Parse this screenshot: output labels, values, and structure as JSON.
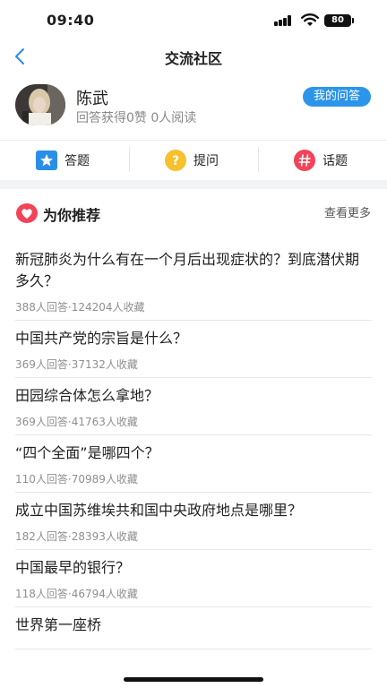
{
  "status": {
    "time": "09:40",
    "battery": "80"
  },
  "nav": {
    "title": "交流社区"
  },
  "profile": {
    "name": "陈武",
    "stats": "回答获得0赞  0人阅读",
    "my_answers": "我的问答"
  },
  "actions": [
    {
      "label": "答题",
      "icon": "star-icon",
      "color": "#2b8ee6"
    },
    {
      "label": "提问",
      "icon": "question-icon",
      "color": "#f6c12c"
    },
    {
      "label": "话题",
      "icon": "hashtag-icon",
      "color": "#f24358"
    }
  ],
  "recommend": {
    "title": "为你推荐",
    "more": "查看更多",
    "icon": "heart-icon",
    "accent": "#f24358"
  },
  "questions": [
    {
      "title": "新冠肺炎为什么有在一个月后出现症状的？到底潜伏期多久？",
      "meta": "388人回答·124204人收藏"
    },
    {
      "title": "中国共产党的宗旨是什么？",
      "meta": "369人回答·37132人收藏"
    },
    {
      "title": "田园综合体怎么拿地？",
      "meta": "369人回答·41763人收藏"
    },
    {
      "title": "“四个全面”是哪四个？",
      "meta": "110人回答·70989人收藏"
    },
    {
      "title": "成立中国苏维埃共和国中央政府地点是哪里？",
      "meta": "182人回答·28393人收藏"
    },
    {
      "title": "中国最早的银行？",
      "meta": "118人回答·46794人收藏"
    },
    {
      "title": "世界第一座桥",
      "meta": ""
    }
  ]
}
